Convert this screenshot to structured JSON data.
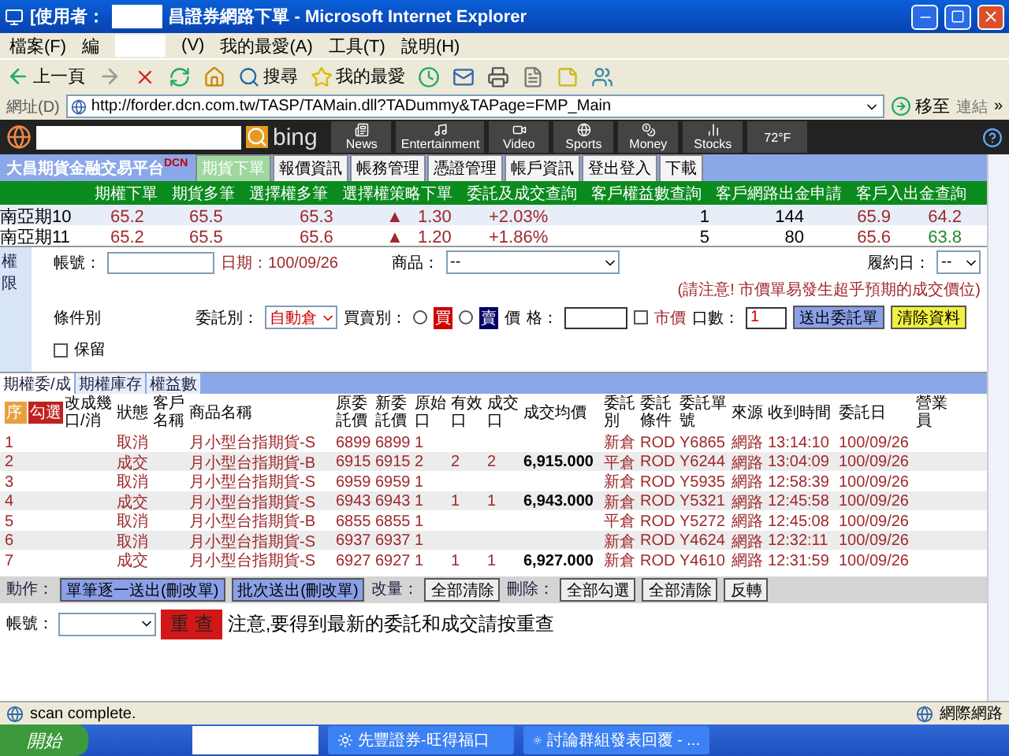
{
  "window": {
    "title_start": "[使用者：",
    "title_end": "昌證券網路下單 - Microsoft Internet Explorer"
  },
  "menu": [
    "檔案(F)",
    "編",
    "(V)",
    "我的最愛(A)",
    "工具(T)",
    "說明(H)"
  ],
  "toolbar": {
    "back": "上一頁",
    "search": "搜尋",
    "favorites": "我的最愛"
  },
  "address": {
    "label": "網址(D)",
    "url": "http://forder.dcn.com.tw/TASP/TAMain.dll?TADummy&TAPage=FMP_Main",
    "go": "移至",
    "links": "連結",
    "more": "»"
  },
  "bing": {
    "logo": "bing",
    "buttons": [
      "News",
      "Entertainment",
      "Video",
      "Sports",
      "Money"
    ],
    "stocks": "Stocks",
    "weather": "72°F"
  },
  "app": {
    "brand": "大昌期貨金融交易平台$^{DCN}$",
    "tabs": [
      {
        "label": "期貨下單",
        "selected": true
      },
      {
        "label": "報價資訊",
        "selected": false
      },
      {
        "label": "帳務管理",
        "selected": false
      },
      {
        "label": "憑證管理",
        "selected": false
      },
      {
        "label": "帳戶資訊",
        "selected": false
      },
      {
        "label": "登出登入",
        "selected": false
      },
      {
        "label": "下載",
        "selected": false
      }
    ],
    "submenu": [
      "期權下單",
      "期貨多筆",
      "選擇權多筆",
      "選擇權策略下單",
      "委託及成交查詢",
      "客戶權益數查詢",
      "客戶網路出金申請",
      "客戶入出金查詢"
    ]
  },
  "quotes": [
    {
      "name": "南亞期10",
      "bid": "65.2",
      "ask": "65.5",
      "last": "65.3",
      "arrow": "▲",
      "change": "1.30",
      "pct": "+2.03%",
      "qty": "1",
      "volume": "144",
      "high": "65.9",
      "low": {
        "text": "64.2",
        "color": "#a0282c"
      }
    },
    {
      "name": "南亞期11",
      "bid": "65.2",
      "ask": "65.5",
      "last": "65.6",
      "arrow": "▲",
      "change": "1.20",
      "pct": "+1.86%",
      "qty": "5",
      "volume": "80",
      "high": "65.6",
      "low": {
        "text": "63.8",
        "color": "#1a8a2a"
      }
    }
  ],
  "order_form": {
    "side_label": "權限",
    "account_label": "帳號：",
    "date": "日期：100/09/26",
    "product_label": "商品：",
    "product": "--",
    "expiry_label": "履約日：",
    "expiry": "--",
    "warning": "(請注意! 市價單易發生超乎預期的成交價位)",
    "condition_label": "條件別",
    "type_label": "委託別：",
    "type": "自動倉",
    "bs_label": "買賣別：",
    "buy": "買",
    "buy_selected": false,
    "sell": "賣",
    "sell_selected": false,
    "price_label1": "價",
    "price_label2": "格：",
    "market": "市價",
    "market_checked": false,
    "qty_label": "口數：",
    "qty": "1",
    "submit": "送出委託單",
    "clear": "清除資料",
    "keep": "保留",
    "keep_checked": false
  },
  "order_tabs": [
    {
      "label": "期權委/成",
      "selected": true
    },
    {
      "label": "期權庫存",
      "selected": false
    },
    {
      "label": "權益數",
      "selected": false
    }
  ],
  "orders": {
    "columns": [
      "序",
      "勾選",
      "改成幾口/消",
      "狀態",
      "客戶名稱",
      "商品名稱",
      "原委託價",
      "新委託價",
      "原始口",
      "有效口",
      "成交口",
      "成交均價",
      "委託別",
      "委託條件",
      "委託單號",
      "來源",
      "收到時間",
      "委託日",
      "營業員"
    ],
    "rows": [
      [
        "1",
        "",
        "",
        "取消",
        "",
        "月小型台指期貨-S",
        "6899",
        "6899",
        "1",
        "",
        "",
        "",
        "新倉",
        "ROD",
        "Y6865",
        "網路",
        "13:14:10",
        "100/09/26"
      ],
      [
        "2",
        "",
        "",
        "成交",
        "",
        "月小型台指期貨-B",
        "6915",
        "6915",
        "2",
        "2",
        "2",
        "6,915.000",
        "平倉",
        "ROD",
        "Y6244",
        "網路",
        "13:04:09",
        "100/09/26"
      ],
      [
        "3",
        "",
        "",
        "取消",
        "",
        "月小型台指期貨-S",
        "6959",
        "6959",
        "1",
        "",
        "",
        "",
        "新倉",
        "ROD",
        "Y5935",
        "網路",
        "12:58:39",
        "100/09/26"
      ],
      [
        "4",
        "",
        "",
        "成交",
        "",
        "月小型台指期貨-S",
        "6943",
        "6943",
        "1",
        "1",
        "1",
        "6,943.000",
        "新倉",
        "ROD",
        "Y5321",
        "網路",
        "12:45:58",
        "100/09/26"
      ],
      [
        "5",
        "",
        "",
        "取消",
        "",
        "月小型台指期貨-B",
        "6855",
        "6855",
        "1",
        "",
        "",
        "",
        "平倉",
        "ROD",
        "Y5272",
        "網路",
        "12:45:08",
        "100/09/26"
      ],
      [
        "6",
        "",
        "",
        "取消",
        "",
        "月小型台指期貨-S",
        "6937",
        "6937",
        "1",
        "",
        "",
        "",
        "新倉",
        "ROD",
        "Y4624",
        "網路",
        "12:32:11",
        "100/09/26"
      ],
      [
        "7",
        "",
        "",
        "成交",
        "",
        "月小型台指期貨-S",
        "6927",
        "6927",
        "1",
        "1",
        "1",
        "6,927.000",
        "新倉",
        "ROD",
        "Y4610",
        "網路",
        "12:31:59",
        "100/09/26"
      ]
    ]
  },
  "actions": {
    "action_label": "動作：",
    "single": "單筆逐一送出(刪改單)",
    "batch": "批次送出(刪改單)",
    "qty_label": "改量：",
    "clear_qty": "全部清除",
    "delete_label": "刪除：",
    "select_all": "全部勾選",
    "clear_all": "全部清除",
    "invert": "反轉"
  },
  "refresh": {
    "account_label": "帳號：",
    "button": "重 查",
    "note": "注意,要得到最新的委託和成交請按重查"
  },
  "status_bar": {
    "text": "scan complete.",
    "zone": "網際網路"
  },
  "taskbar": {
    "start": "開始",
    "tasks": [
      "先豐證券-旺得福口",
      "討論群組發表回覆 - ..."
    ]
  }
}
